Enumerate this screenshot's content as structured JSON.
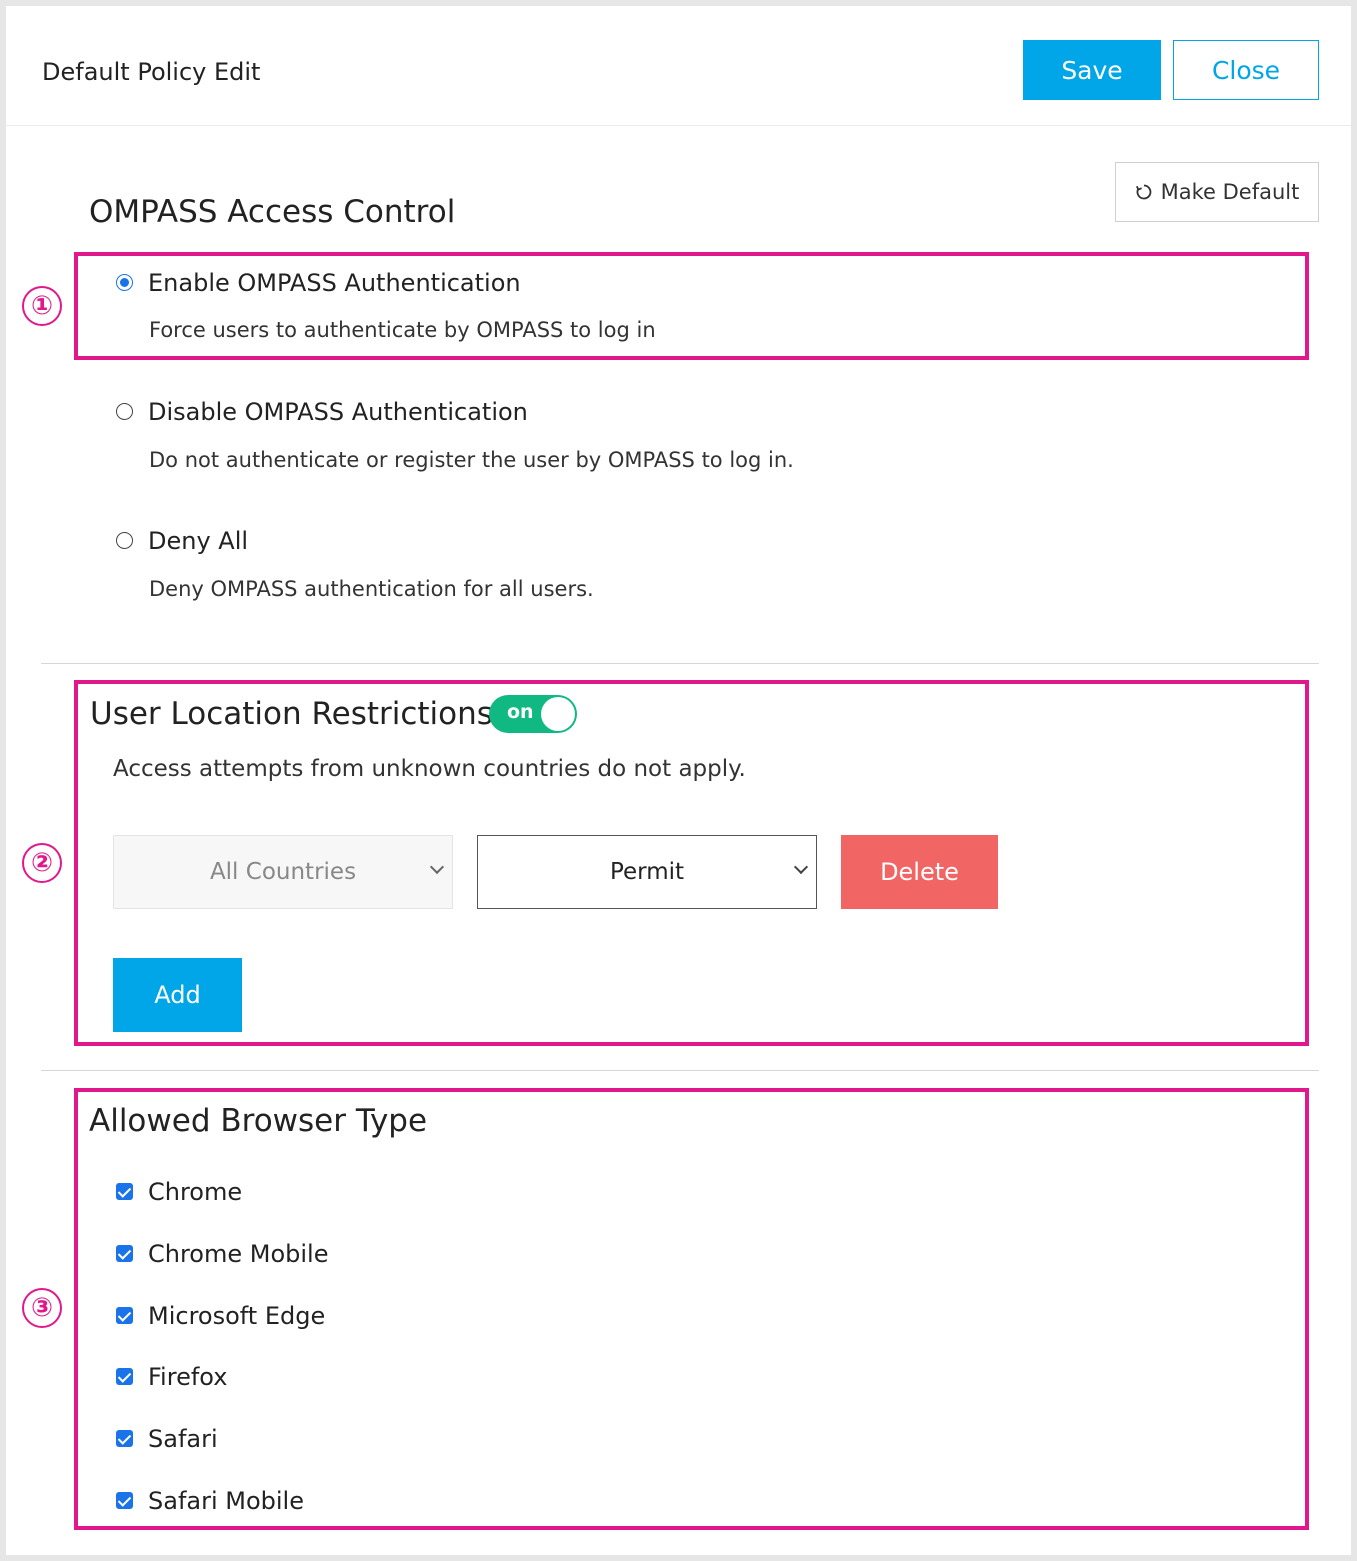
{
  "header": {
    "title": "Default Policy Edit",
    "save_label": "Save",
    "close_label": "Close"
  },
  "make_default_label": "Make Default",
  "access_control": {
    "title": "OMPASS Access Control",
    "options": [
      {
        "label": "Enable OMPASS Authentication",
        "description": "Force users to authenticate by OMPASS to log in",
        "selected": true
      },
      {
        "label": "Disable OMPASS Authentication",
        "description": "Do not authenticate or register the user by OMPASS to log in.",
        "selected": false
      },
      {
        "label": "Deny All",
        "description": "Deny OMPASS authentication for all users.",
        "selected": false
      }
    ]
  },
  "location": {
    "title": "User Location Restrictions",
    "toggle_label": "on",
    "description": "Access attempts from unknown countries do not apply.",
    "country_select": "All Countries",
    "action_select": "Permit",
    "delete_label": "Delete",
    "add_label": "Add"
  },
  "browsers": {
    "title": "Allowed Browser Type",
    "items": [
      {
        "label": "Chrome",
        "checked": true
      },
      {
        "label": "Chrome Mobile",
        "checked": true
      },
      {
        "label": "Microsoft Edge",
        "checked": true
      },
      {
        "label": "Firefox",
        "checked": true
      },
      {
        "label": "Safari",
        "checked": true
      },
      {
        "label": "Safari Mobile",
        "checked": true
      }
    ]
  },
  "markers": [
    "①",
    "②",
    "③"
  ],
  "colors": {
    "accent": "#00a6e8",
    "highlight": "#e0188c",
    "delete": "#f26565",
    "toggle_on": "#10b981"
  }
}
